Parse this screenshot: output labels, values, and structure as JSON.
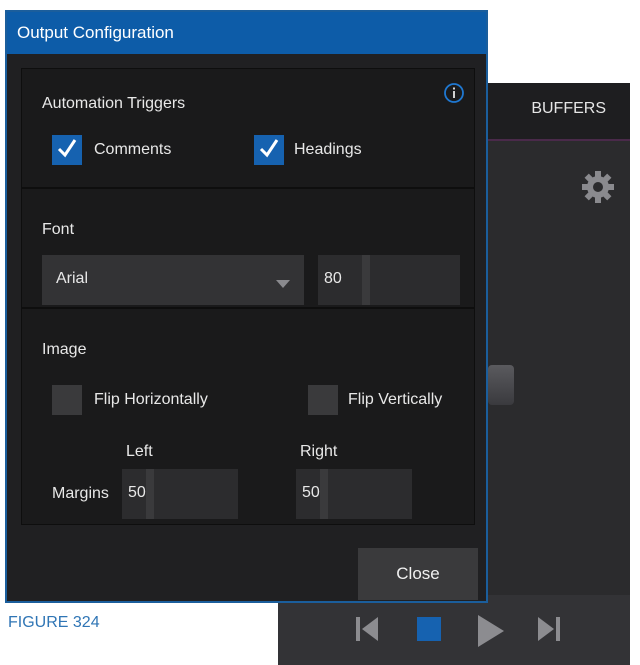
{
  "background_app": {
    "tab_label": "BUFFERS",
    "gear_icon": "gear-icon",
    "transport_icons": [
      "skip-back-icon",
      "stop-icon",
      "play-icon",
      "skip-forward-icon"
    ]
  },
  "dialog": {
    "title": "Output Configuration",
    "automation": {
      "label": "Automation Triggers",
      "info_icon": "info-icon",
      "comments": {
        "label": "Comments",
        "checked": true
      },
      "headings": {
        "label": "Headings",
        "checked": true
      }
    },
    "font": {
      "label": "Font",
      "family_value": "Arial",
      "size_value": "80"
    },
    "image": {
      "label": "Image",
      "flip_horizontal": {
        "label": "Flip Horizontally",
        "checked": false
      },
      "flip_vertical": {
        "label": "Flip Vertically",
        "checked": false
      },
      "left_label": "Left",
      "right_label": "Right",
      "margins_label": "Margins",
      "left_value": "50",
      "right_value": "50"
    },
    "close_label": "Close"
  },
  "caption": "FIGURE 324",
  "colors": {
    "accent": "#0d5ca8",
    "checkbox_on": "#1662b0",
    "caption": "#2f75b5"
  }
}
